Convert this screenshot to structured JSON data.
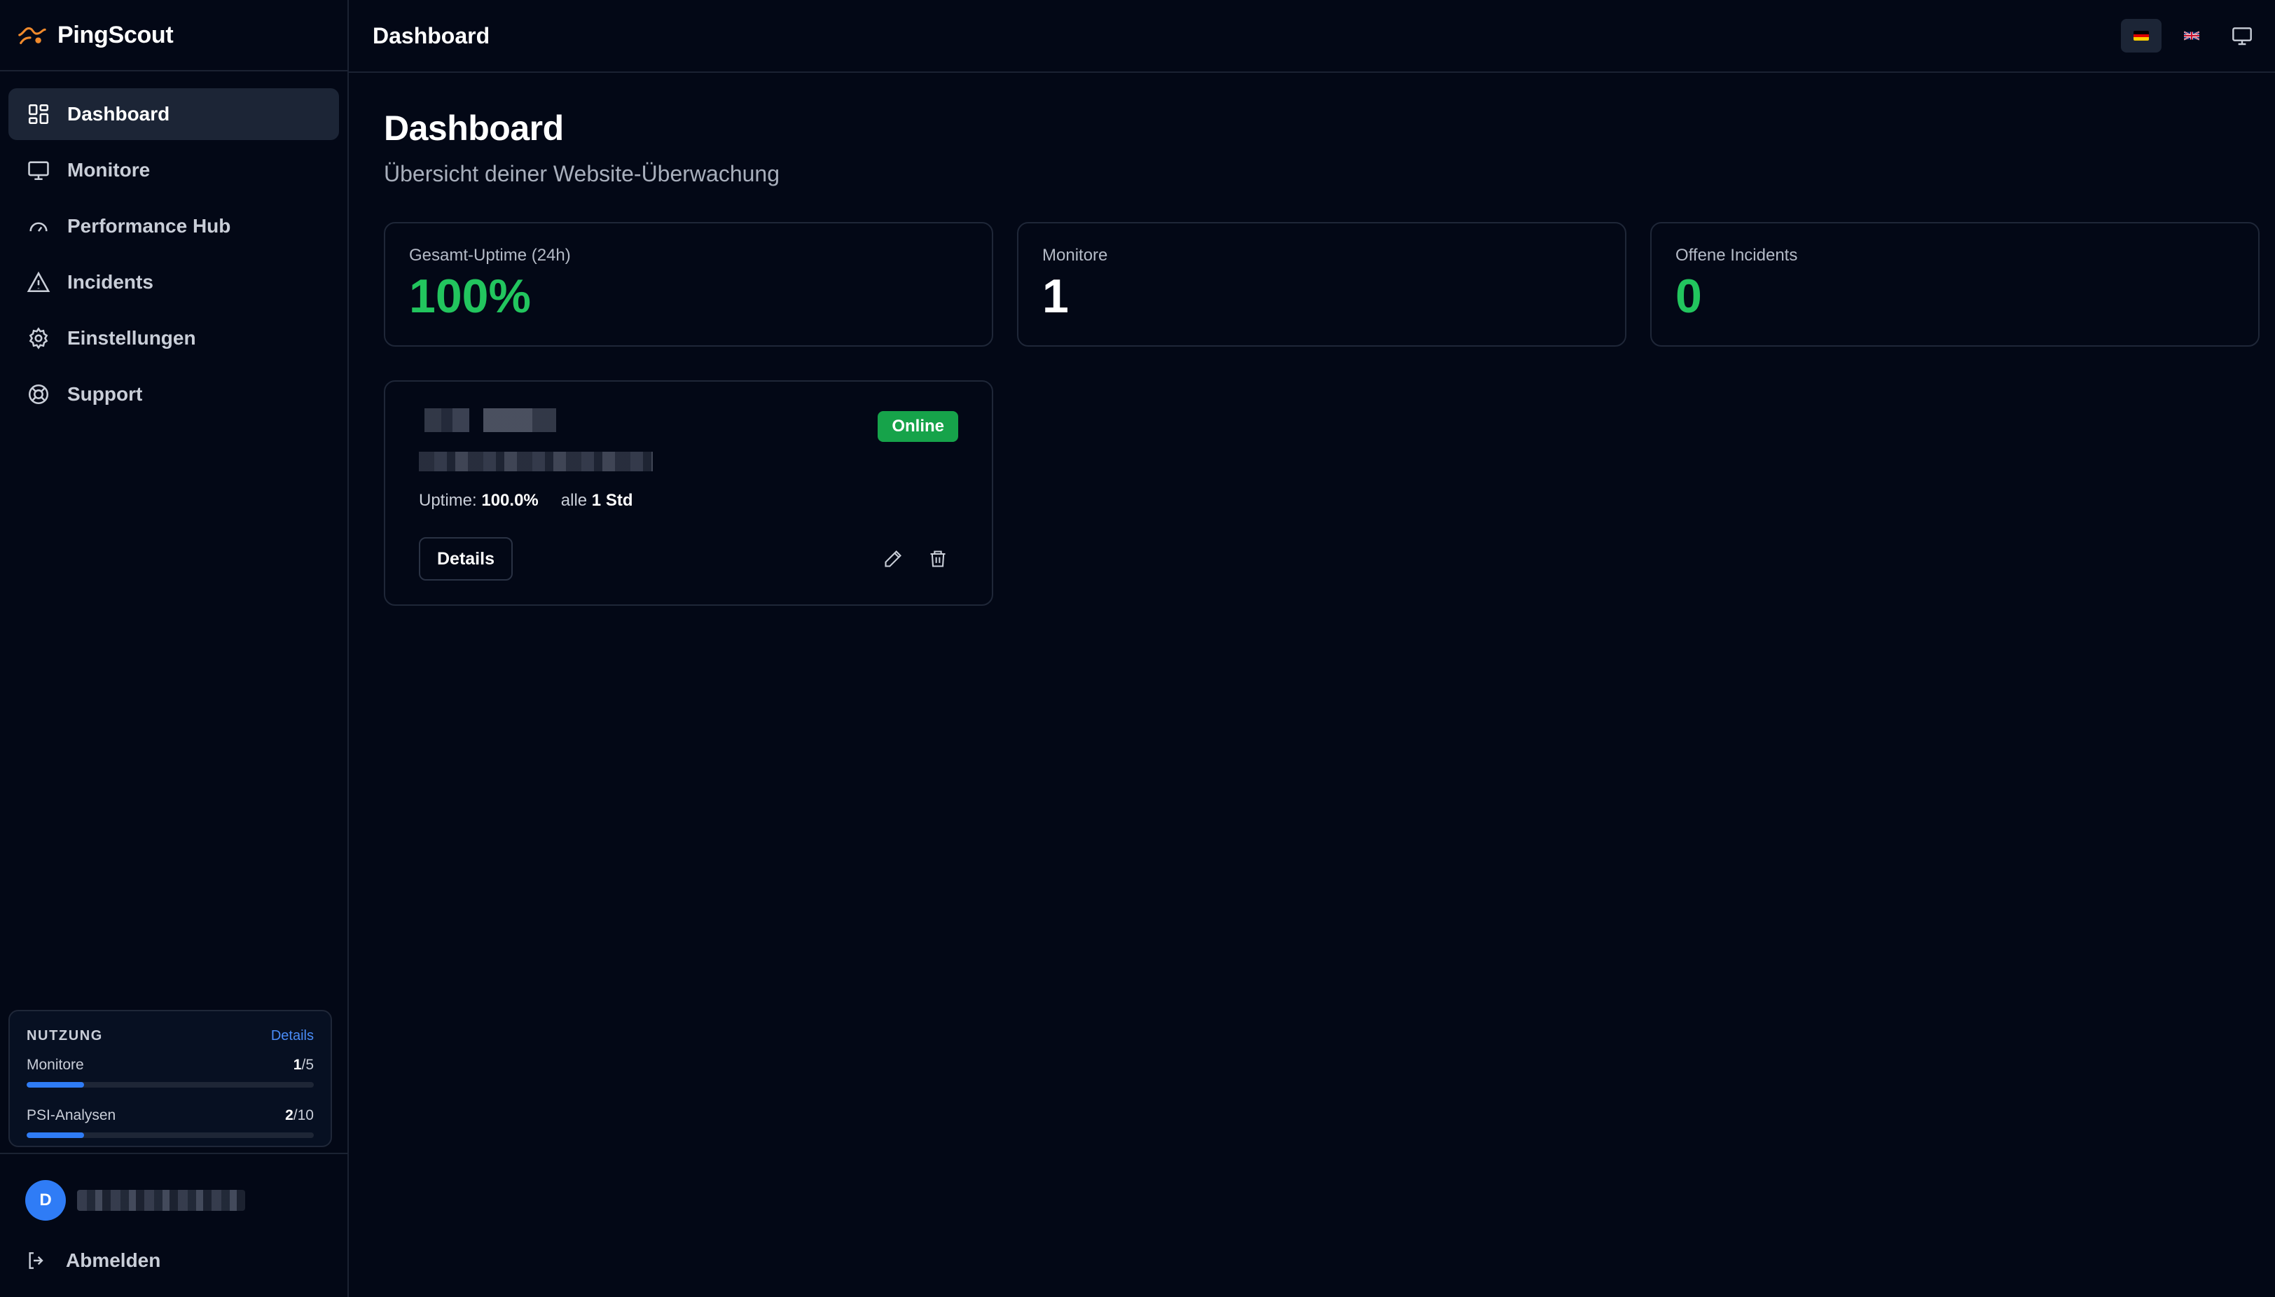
{
  "app": {
    "name": "PingScout"
  },
  "sidebar": {
    "items": [
      {
        "label": "Dashboard",
        "icon": "dashboard-grid-icon",
        "active": true
      },
      {
        "label": "Monitore",
        "icon": "monitor-icon"
      },
      {
        "label": "Performance Hub",
        "icon": "gauge-icon"
      },
      {
        "label": "Incidents",
        "icon": "warning-triangle-icon"
      },
      {
        "label": "Einstellungen",
        "icon": "gear-icon"
      },
      {
        "label": "Support",
        "icon": "lifebuoy-icon"
      }
    ],
    "usage": {
      "title": "NUTZUNG",
      "details_link": "Details",
      "monitors": {
        "label": "Monitore",
        "used": "1",
        "limit": "/5",
        "fraction": 0.2
      },
      "psi": {
        "label": "PSI-Analysen",
        "used": "2",
        "limit": "/10",
        "fraction": 0.2
      }
    },
    "user": {
      "initial": "D"
    },
    "logout_label": "Abmelden"
  },
  "topbar": {
    "title": "Dashboard",
    "languages": [
      "de",
      "en"
    ],
    "active_language": "de"
  },
  "page": {
    "title": "Dashboard",
    "subtitle": "Übersicht deiner Website-Überwachung"
  },
  "stats": {
    "uptime": {
      "label": "Gesamt-Uptime (24h)",
      "value": "100%"
    },
    "monitors": {
      "label": "Monitore",
      "value": "1"
    },
    "incidents": {
      "label": "Offene Incidents",
      "value": "0"
    }
  },
  "monitor_card": {
    "status": "Online",
    "uptime_label": "Uptime:",
    "uptime_value": "100.0%",
    "interval_label": "alle",
    "interval_value": "1 Std",
    "details_button": "Details"
  },
  "colors": {
    "background": "#030816",
    "accent_blue": "#2f7cf6",
    "success_green": "#22c55e",
    "badge_green": "#16a34a"
  }
}
